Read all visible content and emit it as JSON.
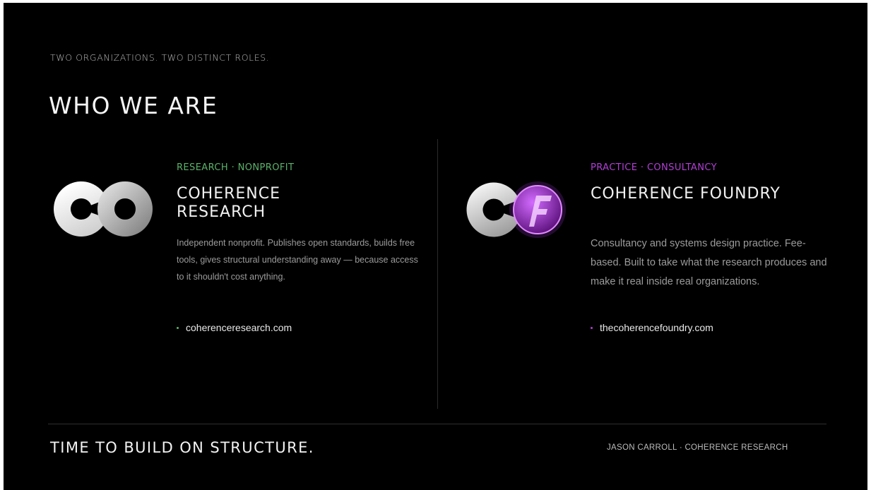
{
  "slide": {
    "eyebrow": "TWO ORGANIZATIONS. TWO DISTINCT ROLES.",
    "title": "WHO WE ARE"
  },
  "research": {
    "tag": "RESEARCH · NONPROFIT",
    "name": "COHERENCE RESEARCH",
    "description": "Independent nonprofit. Publishes open standards, builds free tools, gives structural understanding away — because access to it shouldn't cost anything.",
    "link": "coherenceresearch.com",
    "accent_color": "#5bb36a",
    "logo_icon": "coherence-research-logo"
  },
  "foundry": {
    "tag": "PRACTICE · CONSULTANCY",
    "name": "COHERENCE FOUNDRY",
    "description": "Consultancy and systems design practice. Fee-based. Built to take what the research produces and make it real inside real organizations.",
    "link": "thecoherencefoundry.com",
    "accent_color": "#b23fd6",
    "logo_icon": "coherence-foundry-logo"
  },
  "footer": {
    "tagline": "TIME TO BUILD ON STRUCTURE.",
    "credit": "JASON CARROLL · COHERENCE RESEARCH"
  }
}
